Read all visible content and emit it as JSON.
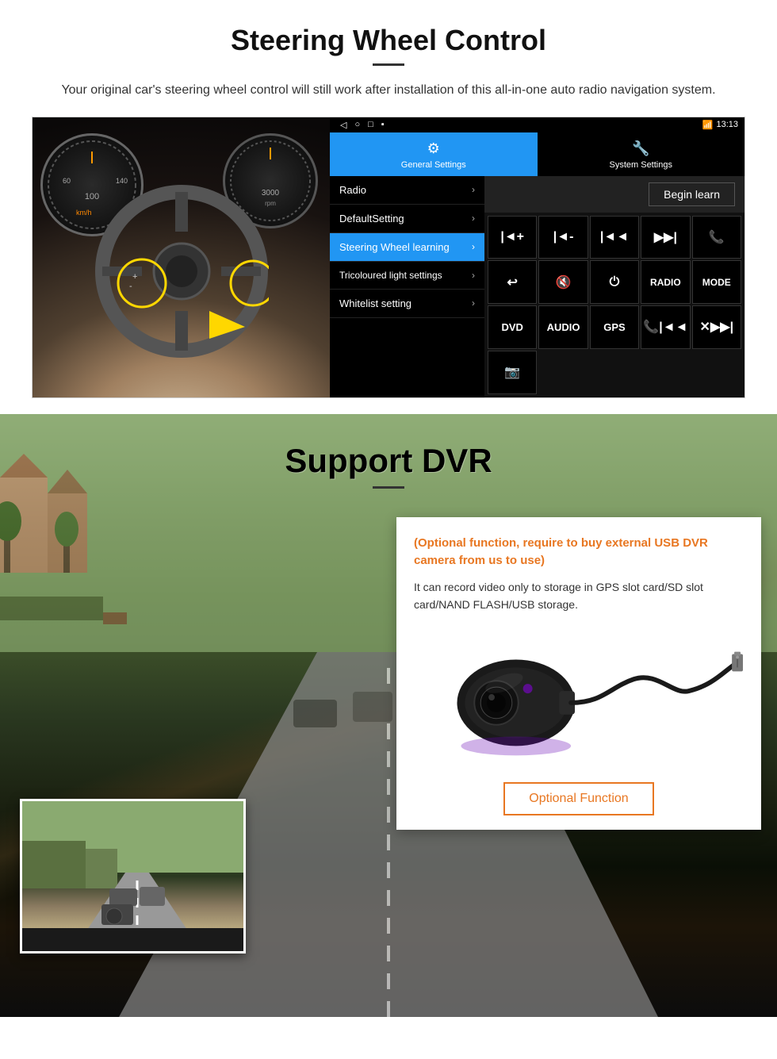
{
  "page": {
    "section1": {
      "title": "Steering Wheel Control",
      "description": "Your original car's steering wheel control will still work after installation of this all-in-one auto radio navigation system.",
      "android_ui": {
        "status_bar": {
          "time": "13:13",
          "signal_icon": "◀",
          "home_icon": "○",
          "square_icon": "□",
          "menu_icon": "■"
        },
        "tabs": [
          {
            "label": "General Settings",
            "icon": "⚙",
            "active": true
          },
          {
            "label": "System Settings",
            "icon": "🔧",
            "active": false
          }
        ],
        "menu_items": [
          {
            "label": "Radio",
            "active": false
          },
          {
            "label": "DefaultSetting",
            "active": false
          },
          {
            "label": "Steering Wheel learning",
            "active": true
          },
          {
            "label": "Tricoloured light settings",
            "active": false
          },
          {
            "label": "Whitelist setting",
            "active": false
          }
        ],
        "controls": {
          "begin_learn": "Begin learn",
          "buttons": [
            "vol+",
            "vol-",
            "prev",
            "next",
            "phone",
            "back",
            "mute",
            "power",
            "RADIO",
            "MODE",
            "DVD",
            "AUDIO",
            "GPS",
            "prev-call",
            "skip",
            "cam"
          ]
        }
      }
    },
    "section2": {
      "title": "Support DVR",
      "divider": true,
      "optional_text": "(Optional function, require to buy external USB DVR camera from us to use)",
      "description": "It can record video only to storage in GPS slot card/SD slot card/NAND FLASH/USB storage.",
      "optional_function_btn": "Optional Function"
    }
  }
}
